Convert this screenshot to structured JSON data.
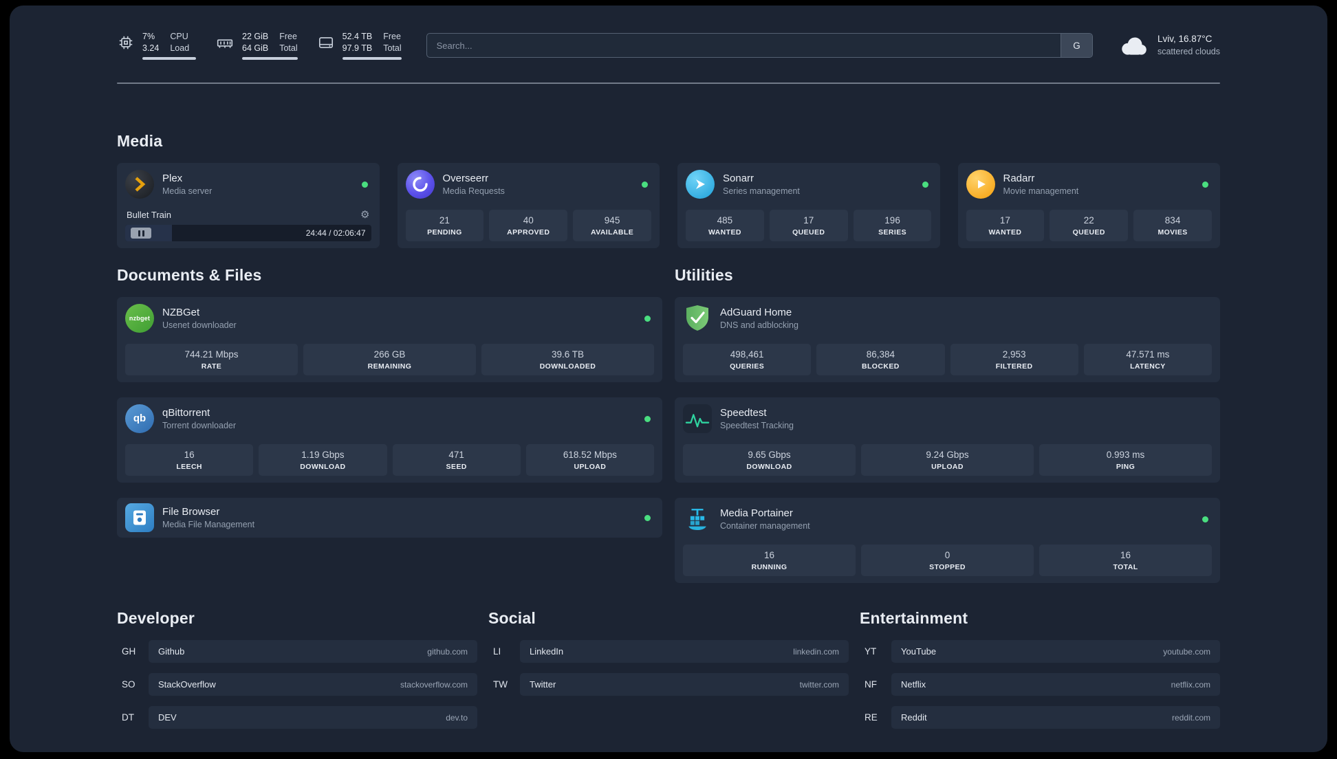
{
  "header": {
    "cpu": {
      "value_top": "7%",
      "value_bottom": "3.24",
      "label_top": "CPU",
      "label_bottom": "Load",
      "bar_pct": 100
    },
    "memory": {
      "value_top": "22 GiB",
      "value_bottom": "64 GiB",
      "label_top": "Free",
      "label_bottom": "Total",
      "bar_pct": 100
    },
    "disk": {
      "value_top": "52.4 TB",
      "value_bottom": "97.9 TB",
      "label_top": "Free",
      "label_bottom": "Total",
      "bar_pct": 100
    },
    "search": {
      "placeholder": "Search...",
      "provider": "G"
    },
    "weather": {
      "location": "Lviv, 16.87°C",
      "condition": "scattered clouds"
    }
  },
  "media": {
    "title": "Media",
    "plex": {
      "name": "Plex",
      "subtitle": "Media server",
      "now_playing": "Bullet Train",
      "time": "24:44 / 02:06:47",
      "progress_pct": 19
    },
    "overseerr": {
      "name": "Overseerr",
      "subtitle": "Media Requests",
      "stats": [
        {
          "value": "21",
          "label": "PENDING"
        },
        {
          "value": "40",
          "label": "APPROVED"
        },
        {
          "value": "945",
          "label": "AVAILABLE"
        }
      ]
    },
    "sonarr": {
      "name": "Sonarr",
      "subtitle": "Series management",
      "stats": [
        {
          "value": "485",
          "label": "WANTED"
        },
        {
          "value": "17",
          "label": "QUEUED"
        },
        {
          "value": "196",
          "label": "SERIES"
        }
      ]
    },
    "radarr": {
      "name": "Radarr",
      "subtitle": "Movie management",
      "stats": [
        {
          "value": "17",
          "label": "WANTED"
        },
        {
          "value": "22",
          "label": "QUEUED"
        },
        {
          "value": "834",
          "label": "MOVIES"
        }
      ]
    }
  },
  "documents": {
    "title": "Documents & Files",
    "nzbget": {
      "name": "NZBGet",
      "subtitle": "Usenet downloader",
      "stats": [
        {
          "value": "744.21 Mbps",
          "label": "RATE"
        },
        {
          "value": "266 GB",
          "label": "REMAINING"
        },
        {
          "value": "39.6 TB",
          "label": "DOWNLOADED"
        }
      ]
    },
    "qbittorrent": {
      "name": "qBittorrent",
      "subtitle": "Torrent downloader",
      "stats": [
        {
          "value": "16",
          "label": "LEECH"
        },
        {
          "value": "1.19 Gbps",
          "label": "DOWNLOAD"
        },
        {
          "value": "471",
          "label": "SEED"
        },
        {
          "value": "618.52 Mbps",
          "label": "UPLOAD"
        }
      ]
    },
    "filebrowser": {
      "name": "File Browser",
      "subtitle": "Media File Management"
    }
  },
  "utilities": {
    "title": "Utilities",
    "adguard": {
      "name": "AdGuard Home",
      "subtitle": "DNS and adblocking",
      "stats": [
        {
          "value": "498,461",
          "label": "QUERIES"
        },
        {
          "value": "86,384",
          "label": "BLOCKED"
        },
        {
          "value": "2,953",
          "label": "FILTERED"
        },
        {
          "value": "47.571 ms",
          "label": "LATENCY"
        }
      ]
    },
    "speedtest": {
      "name": "Speedtest",
      "subtitle": "Speedtest Tracking",
      "stats": [
        {
          "value": "9.65 Gbps",
          "label": "DOWNLOAD"
        },
        {
          "value": "9.24 Gbps",
          "label": "UPLOAD"
        },
        {
          "value": "0.993 ms",
          "label": "PING"
        }
      ]
    },
    "portainer": {
      "name": "Media Portainer",
      "subtitle": "Container management",
      "stats": [
        {
          "value": "16",
          "label": "RUNNING"
        },
        {
          "value": "0",
          "label": "STOPPED"
        },
        {
          "value": "16",
          "label": "TOTAL"
        }
      ]
    }
  },
  "bookmarks": {
    "developer": {
      "title": "Developer",
      "items": [
        {
          "abbr": "GH",
          "name": "Github",
          "domain": "github.com"
        },
        {
          "abbr": "SO",
          "name": "StackOverflow",
          "domain": "stackoverflow.com"
        },
        {
          "abbr": "DT",
          "name": "DEV",
          "domain": "dev.to"
        }
      ]
    },
    "social": {
      "title": "Social",
      "items": [
        {
          "abbr": "LI",
          "name": "LinkedIn",
          "domain": "linkedin.com"
        },
        {
          "abbr": "TW",
          "name": "Twitter",
          "domain": "twitter.com"
        }
      ]
    },
    "entertainment": {
      "title": "Entertainment",
      "items": [
        {
          "abbr": "YT",
          "name": "YouTube",
          "domain": "youtube.com"
        },
        {
          "abbr": "NF",
          "name": "Netflix",
          "domain": "netflix.com"
        },
        {
          "abbr": "RE",
          "name": "Reddit",
          "domain": "reddit.com"
        }
      ]
    }
  },
  "icons": {
    "gear": "⚙",
    "nzbget_text": "nzbget",
    "qbittorrent_text": "qb"
  },
  "colors": {
    "status_online": "#4ade80",
    "accent_green": "#2fd4a0"
  }
}
